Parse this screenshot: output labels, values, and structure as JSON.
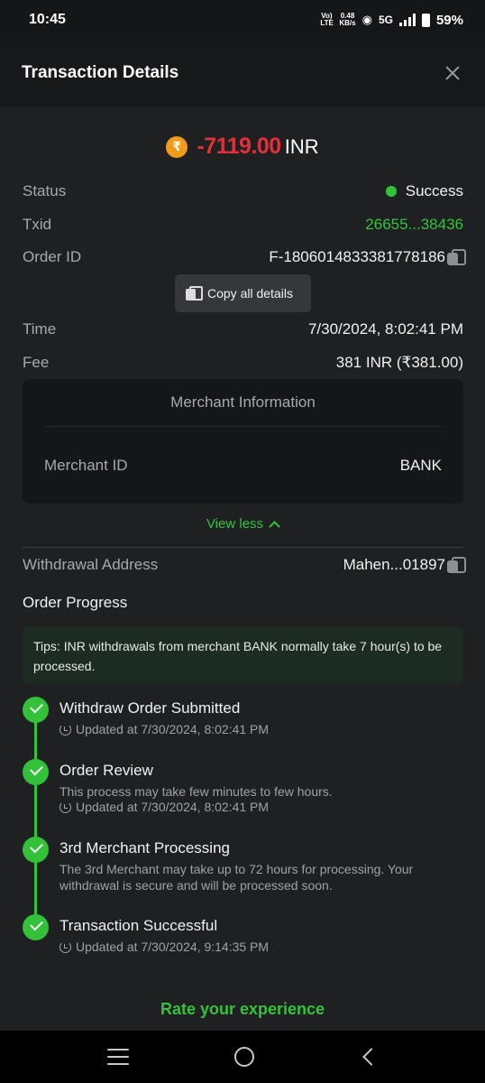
{
  "status_bar": {
    "time": "10:45",
    "volte": "Vo) LTE",
    "speed_value": "0.48",
    "speed_unit": "KB/s",
    "network": "5G",
    "battery": "59%"
  },
  "header": {
    "title": "Transaction Details"
  },
  "amount": {
    "value": "-7119.00",
    "currency": "INR",
    "coin_symbol": "₹"
  },
  "details": {
    "status_label": "Status",
    "status_value": "Success",
    "txid_label": "Txid",
    "txid_value": "26655...38436",
    "order_label": "Order ID",
    "order_value": "F-1806014833381778186",
    "time_label": "Time",
    "time_value": "7/30/2024, 8:02:41 PM",
    "fee_label": "Fee",
    "fee_value": "381 INR (₹381.00)"
  },
  "tooltip": {
    "label": "Copy all details"
  },
  "merchant": {
    "title": "Merchant Information",
    "id_label": "Merchant ID",
    "id_value": "BANK"
  },
  "view_less": "View less",
  "withdrawal": {
    "label": "Withdrawal Address",
    "value": "Mahen...01897"
  },
  "progress": {
    "title": "Order Progress",
    "tips": "Tips: INR withdrawals from merchant BANK normally take 7 hour(s) to be processed.",
    "steps": [
      {
        "title": "Withdraw Order Submitted",
        "desc": "",
        "updated": "Updated at 7/30/2024, 8:02:41 PM"
      },
      {
        "title": "Order Review",
        "desc": "This process may take few minutes to few hours.",
        "updated": "Updated at 7/30/2024, 8:02:41 PM"
      },
      {
        "title": "3rd Merchant Processing",
        "desc": "The 3rd Merchant may take up to 72 hours for processing. Your withdrawal is secure and will be processed soon.",
        "updated": ""
      },
      {
        "title": "Transaction Successful",
        "desc": "",
        "updated": "Updated at 7/30/2024, 9:14:35 PM"
      }
    ]
  },
  "rate_label": "Rate your experience",
  "colors": {
    "accent_green": "#35c23c",
    "amount_red": "#e0303a",
    "coin_orange": "#f29a1a"
  }
}
